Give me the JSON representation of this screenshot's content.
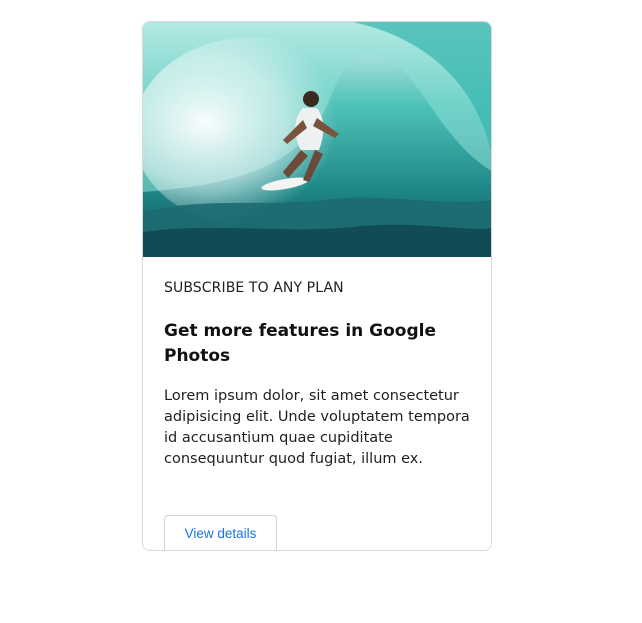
{
  "card": {
    "image_alt": "surfer riding a wave",
    "eyebrow": "SUBSCRIBE TO ANY PLAN",
    "title": "Get more features in Google Photos",
    "description": "Lorem ipsum dolor, sit amet consectetur adipisicing elit. Unde voluptatem tempora id accusantium quae cupiditate consequuntur quod fugiat, illum ex.",
    "button_label": "View details"
  },
  "colors": {
    "accent": "#1a73e8",
    "border": "#d9d9d9",
    "text": "#1f1f1f"
  }
}
